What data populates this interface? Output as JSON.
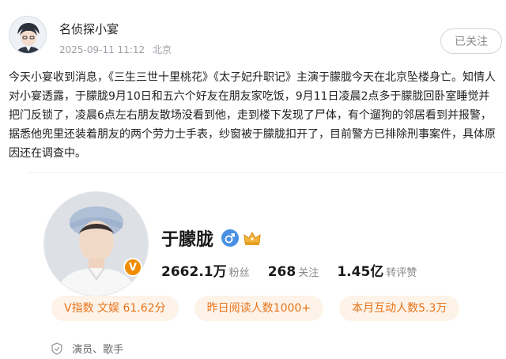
{
  "post": {
    "author": "名侦探小宴",
    "timestamp": "2025-09-11 11:12",
    "location": "北京",
    "follow_label": "已关注",
    "text": "今天小宴收到消息，《三生三世十里桃花》《太子妃升职记》主演于朦胧今天在北京坠楼身亡。知情人对小宴透露，于朦胧9月10日和五六个好友在朋友家吃饭，9月11日凌晨2点多于朦胧回卧室睡觉并把门反锁了，凌晨6点左右朋友散场没看到他，走到楼下发现了尸体，有个遛狗的邻居看到并报警，据悉他兜里还装着朋友的两个劳力士手表，纱窗被于朦胧扣开了，目前警方已排除刑事案件，具体原因还在调查中。"
  },
  "profile_card": {
    "name": "于朦胧",
    "badge_letter": "V",
    "followers_value": "2662.1万",
    "followers_label": "粉丝",
    "following_value": "268",
    "following_label": "关注",
    "engagement_value": "1.45亿",
    "engagement_label": "转评赞",
    "tags": [
      "V指数 文娱 61.62分",
      "昨日阅读人数1000+",
      "本月互动人数5.3万"
    ],
    "verification": "演员、歌手",
    "colors": {
      "accent": "#e8731a",
      "tag_bg": "#fdf3e9",
      "gender_blue": "#4a90e2",
      "badge_orange": "#f08c00"
    }
  }
}
